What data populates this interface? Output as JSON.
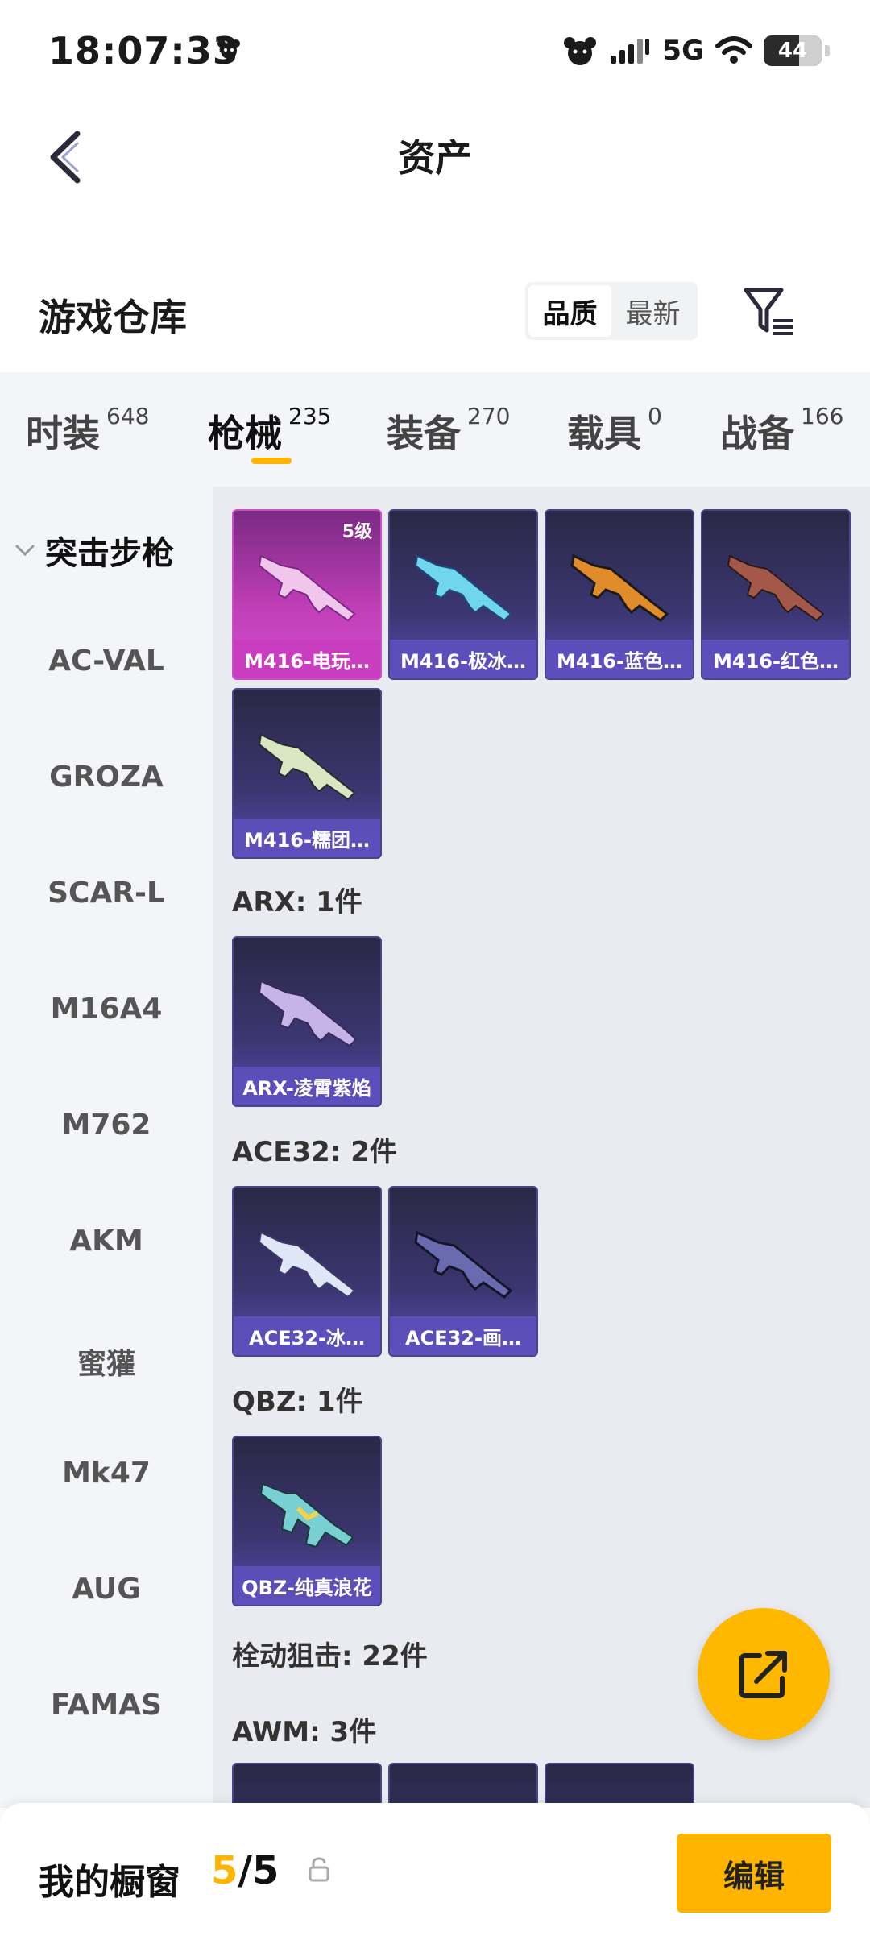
{
  "status_bar": {
    "time": "18:07:33",
    "network": "5G",
    "battery": "44"
  },
  "header": {
    "title": "资产"
  },
  "warehouse": {
    "title": "游戏仓库",
    "sort_options": [
      "品质",
      "最新"
    ],
    "active_sort": "品质"
  },
  "tabs": [
    {
      "label": "时装",
      "count": "648"
    },
    {
      "label": "枪械",
      "count": "235"
    },
    {
      "label": "装备",
      "count": "270"
    },
    {
      "label": "载具",
      "count": "0"
    },
    {
      "label": "战备",
      "count": "166"
    }
  ],
  "active_tab": "枪械",
  "sidebar": {
    "header": "突击步枪",
    "items": [
      "AC-VAL",
      "GROZA",
      "SCAR-L",
      "M16A4",
      "M762",
      "AKM",
      "蜜獾",
      "Mk47",
      "AUG",
      "FAMAS"
    ]
  },
  "content": {
    "m416_cards": [
      {
        "name": "M416-电玩…",
        "level": "5级",
        "style": "pink"
      },
      {
        "name": "M416-极冰…"
      },
      {
        "name": "M416-蓝色…"
      },
      {
        "name": "M416-红色…"
      },
      {
        "name": "M416-糯团…"
      }
    ],
    "sections": [
      {
        "label": "ARX: 1件",
        "cards": [
          "ARX-凌霄紫焰"
        ]
      },
      {
        "label": "ACE32: 2件",
        "cards": [
          "ACE32-冰…",
          "ACE32-画…"
        ]
      },
      {
        "label": "QBZ: 1件",
        "cards": [
          "QBZ-纯真浪花"
        ]
      },
      {
        "label": "栓动狙击: 22件",
        "cards": []
      },
      {
        "label": "AWM: 3件",
        "cards": []
      }
    ]
  },
  "bottom_bar": {
    "showcase_label": "我的橱窗",
    "showcase_current": "5",
    "showcase_sep": "/",
    "showcase_total": "5",
    "edit_label": "编辑"
  },
  "colors": {
    "accent": "#ffb400",
    "card_purple": "#3b3670",
    "card_pink": "#c23fb8",
    "background_gray": "#e9ebf0"
  }
}
